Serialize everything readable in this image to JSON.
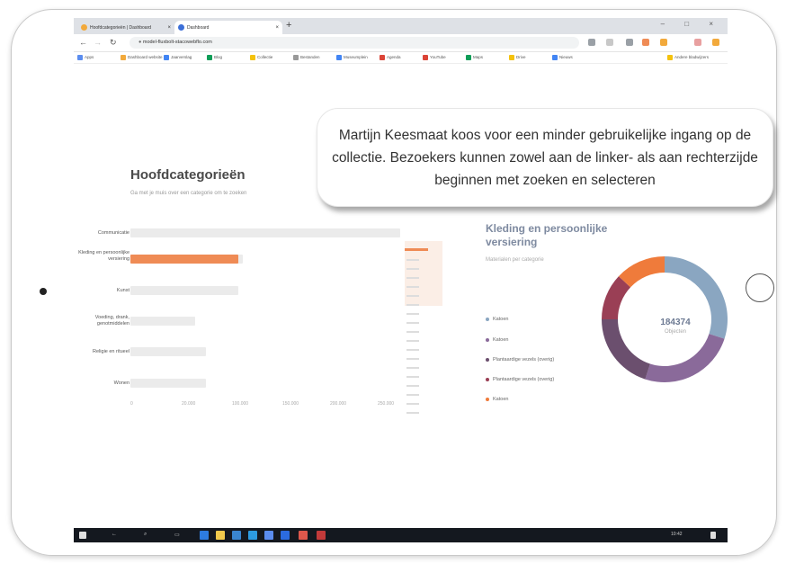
{
  "browser": {
    "tabs": [
      {
        "label": "Hoofdcategorieën | Dashboard",
        "icon": "orange-favicon-icon",
        "color": "#f2a93b"
      },
      {
        "label": "Dashboard",
        "icon": "chrome-favicon-icon",
        "color": "#3b6fd8"
      }
    ],
    "url": "model-fluxbolt-stacowebflo.com",
    "window_controls": "– □ ×",
    "bookmarks": [
      {
        "label": "Apps",
        "color": "#5b8def"
      },
      {
        "label": "Dashboard website",
        "color": "#f2a93b"
      },
      {
        "label": "Jaarverslag",
        "color": "#4285f4"
      },
      {
        "label": "Blog",
        "color": "#0f9d58"
      },
      {
        "label": "Collectie",
        "color": "#f4c20d"
      },
      {
        "label": "Bestanden",
        "color": "#999999"
      },
      {
        "label": "Museumplein",
        "color": "#4285f4"
      },
      {
        "label": "Agenda",
        "color": "#db4437"
      },
      {
        "label": "YouTube",
        "color": "#db4437"
      },
      {
        "label": "Maps",
        "color": "#0f9d58"
      },
      {
        "label": "Drive",
        "color": "#f4c20d"
      },
      {
        "label": "Nieuws",
        "color": "#4285f4"
      },
      {
        "label": "Andere bladwijzers",
        "color": "#f4c20d"
      }
    ]
  },
  "page": {
    "title": "Hoofdcategorieën",
    "subtitle": "Ga met je muis over een categorie om te zoeken"
  },
  "chart_data": [
    {
      "type": "bar",
      "orientation": "horizontal",
      "categories": [
        "Communicatie",
        "Kleding en persoonlijke versiering",
        "Kunst",
        "Voeding, drank, genotmiddelen",
        "Religie en ritueel",
        "Wonen"
      ],
      "values": [
        250000,
        100000,
        100000,
        60000,
        70000,
        70000
      ],
      "highlighted": "Kleding en persoonlijke versiering",
      "x_ticks": [
        "0",
        "20.000",
        "100.000",
        "150.000",
        "200.000",
        "250.000"
      ],
      "xlim": [
        0,
        250000
      ],
      "colors": {
        "track": "#ebebeb",
        "highlight": "#ef8b55"
      }
    },
    {
      "type": "pie",
      "title": "Kleding en persoonlijke versiering",
      "subtitle": "Materialen per categorie",
      "total": "184374",
      "total_label": "Objecten",
      "series": [
        {
          "name": "Katoen",
          "value": 30,
          "color": "#8aa6c1"
        },
        {
          "name": "Katoen",
          "value": 25,
          "color": "#8a6a9a"
        },
        {
          "name": "Plantaardige vezels",
          "value": 20,
          "color": "#6b4f6e"
        },
        {
          "name": "Plantaardige vezels",
          "value": 12,
          "color": "#9a3f55"
        },
        {
          "name": "Katoen",
          "value": 13,
          "color": "#ef7b3b"
        }
      ]
    }
  ],
  "legend": [
    {
      "label": "Katoen",
      "color": "#8aa6c1"
    },
    {
      "label": "Katoen",
      "color": "#8a6a9a"
    },
    {
      "label": "Plantaardige vezels (overig)",
      "color": "#6b4f6e"
    },
    {
      "label": "Plantaardige vezels (overig)",
      "color": "#9a3f55"
    },
    {
      "label": "Katoen",
      "color": "#ef7b3b"
    }
  ],
  "taskbar": {
    "clock": "10:42"
  },
  "callout": {
    "text": "Martijn Keesmaat koos voor een minder gebruikelijke ingang op de collectie. Bezoekers kunnen zowel aan de linker- als aan rechterzijde beginnen met zoeken en selecteren"
  }
}
